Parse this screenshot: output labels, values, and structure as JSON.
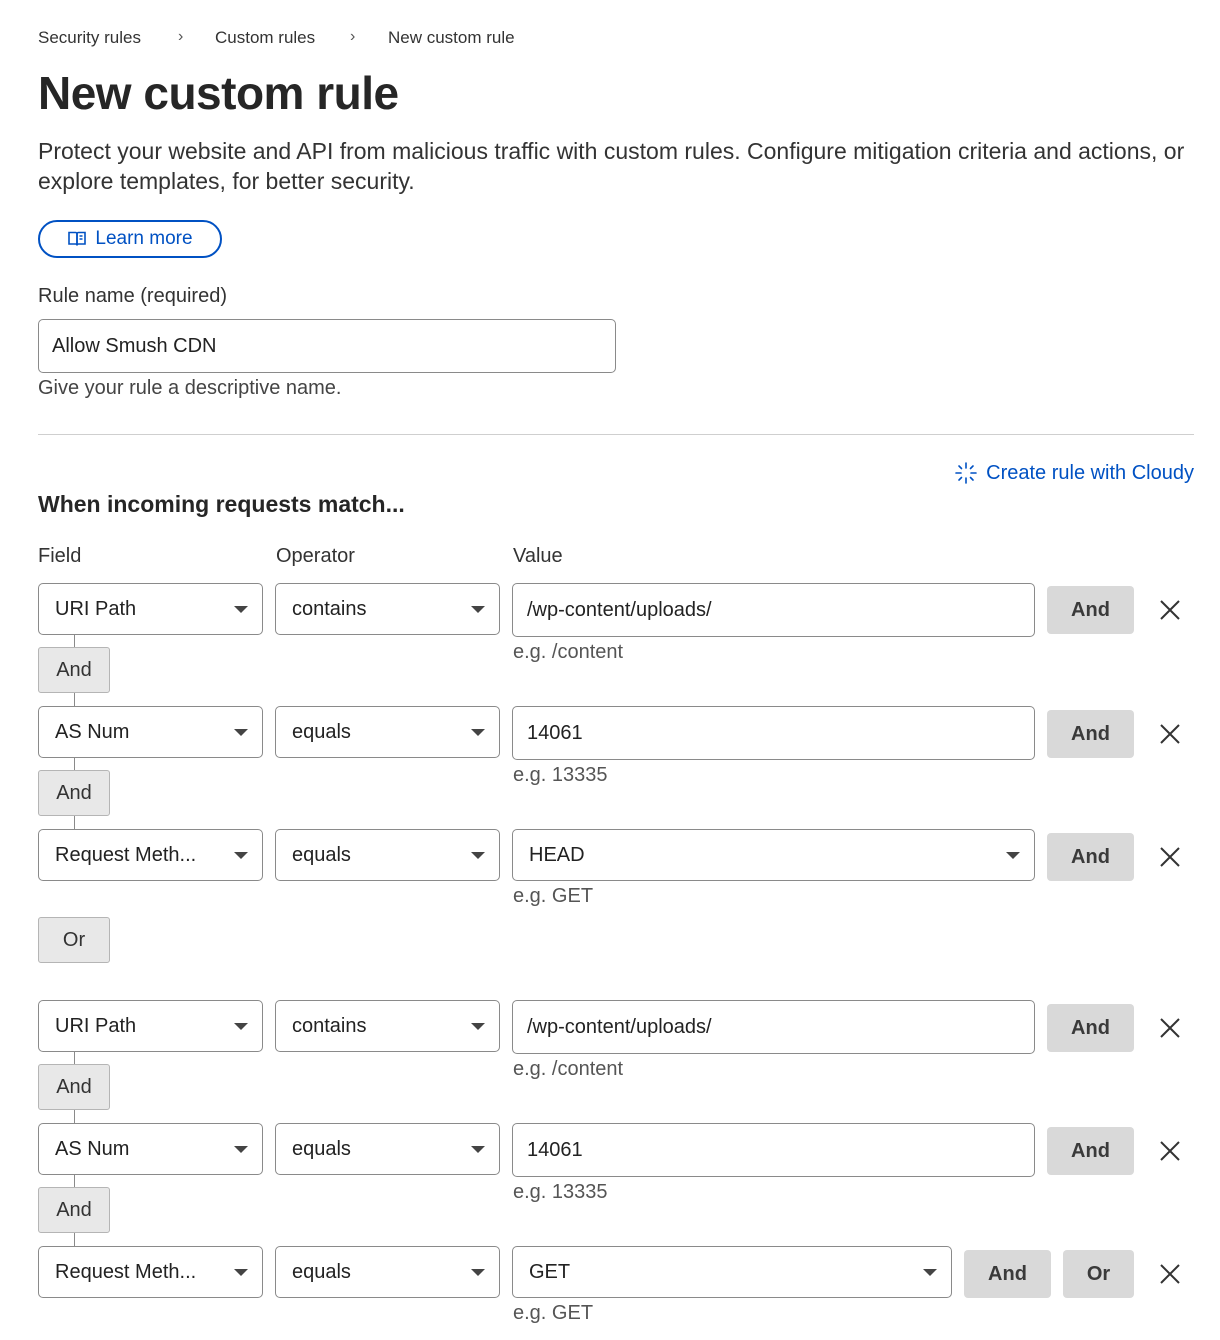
{
  "breadcrumb": {
    "item1": "Security rules",
    "item2": "Custom rules",
    "item3": "New custom rule",
    "separator": "›"
  },
  "page": {
    "title": "New custom rule",
    "description": "Protect your website and API from malicious traffic with custom rules. Configure mitigation criteria and actions, or explore templates, for better security.",
    "learn_more": "Learn more"
  },
  "rule_name": {
    "label": "Rule name (required)",
    "value": "Allow Smush CDN",
    "helper": "Give your rule a descriptive name."
  },
  "cloudy_link": "Create rule with Cloudy",
  "section_heading": "When incoming requests match...",
  "columns": {
    "field": "Field",
    "operator": "Operator",
    "value": "Value"
  },
  "groups": [
    {
      "rows": [
        {
          "field": "URI Path",
          "operator": "contains",
          "value": "/wp-content/uploads/",
          "hint": "e.g. /content",
          "and_label": "And"
        },
        {
          "field": "AS Num",
          "operator": "equals",
          "value": "14061",
          "hint": "e.g. 13335",
          "and_label": "And"
        },
        {
          "field": "Request Meth...",
          "operator": "equals",
          "value": "HEAD",
          "hint": "e.g. GET",
          "and_label": "And"
        }
      ],
      "connectors": [
        "And",
        "And"
      ]
    },
    {
      "rows": [
        {
          "field": "URI Path",
          "operator": "contains",
          "value": "/wp-content/uploads/",
          "hint": "e.g. /content",
          "and_label": "And"
        },
        {
          "field": "AS Num",
          "operator": "equals",
          "value": "14061",
          "hint": "e.g. 13335",
          "and_label": "And"
        },
        {
          "field": "Request Meth...",
          "operator": "equals",
          "value": "GET",
          "hint": "e.g. GET",
          "and_label": "And",
          "or_label": "Or"
        }
      ],
      "connectors": [
        "And",
        "And"
      ]
    }
  ],
  "group_connector": "Or",
  "colors": {
    "link": "#0051c3",
    "button_gray": "#d9d9d9",
    "border": "#8a8a8a"
  },
  "icons": {
    "learn_more": "book-icon",
    "cloudy": "sparkle-icon",
    "remove": "close-icon",
    "dropdown": "caret-down-icon"
  }
}
